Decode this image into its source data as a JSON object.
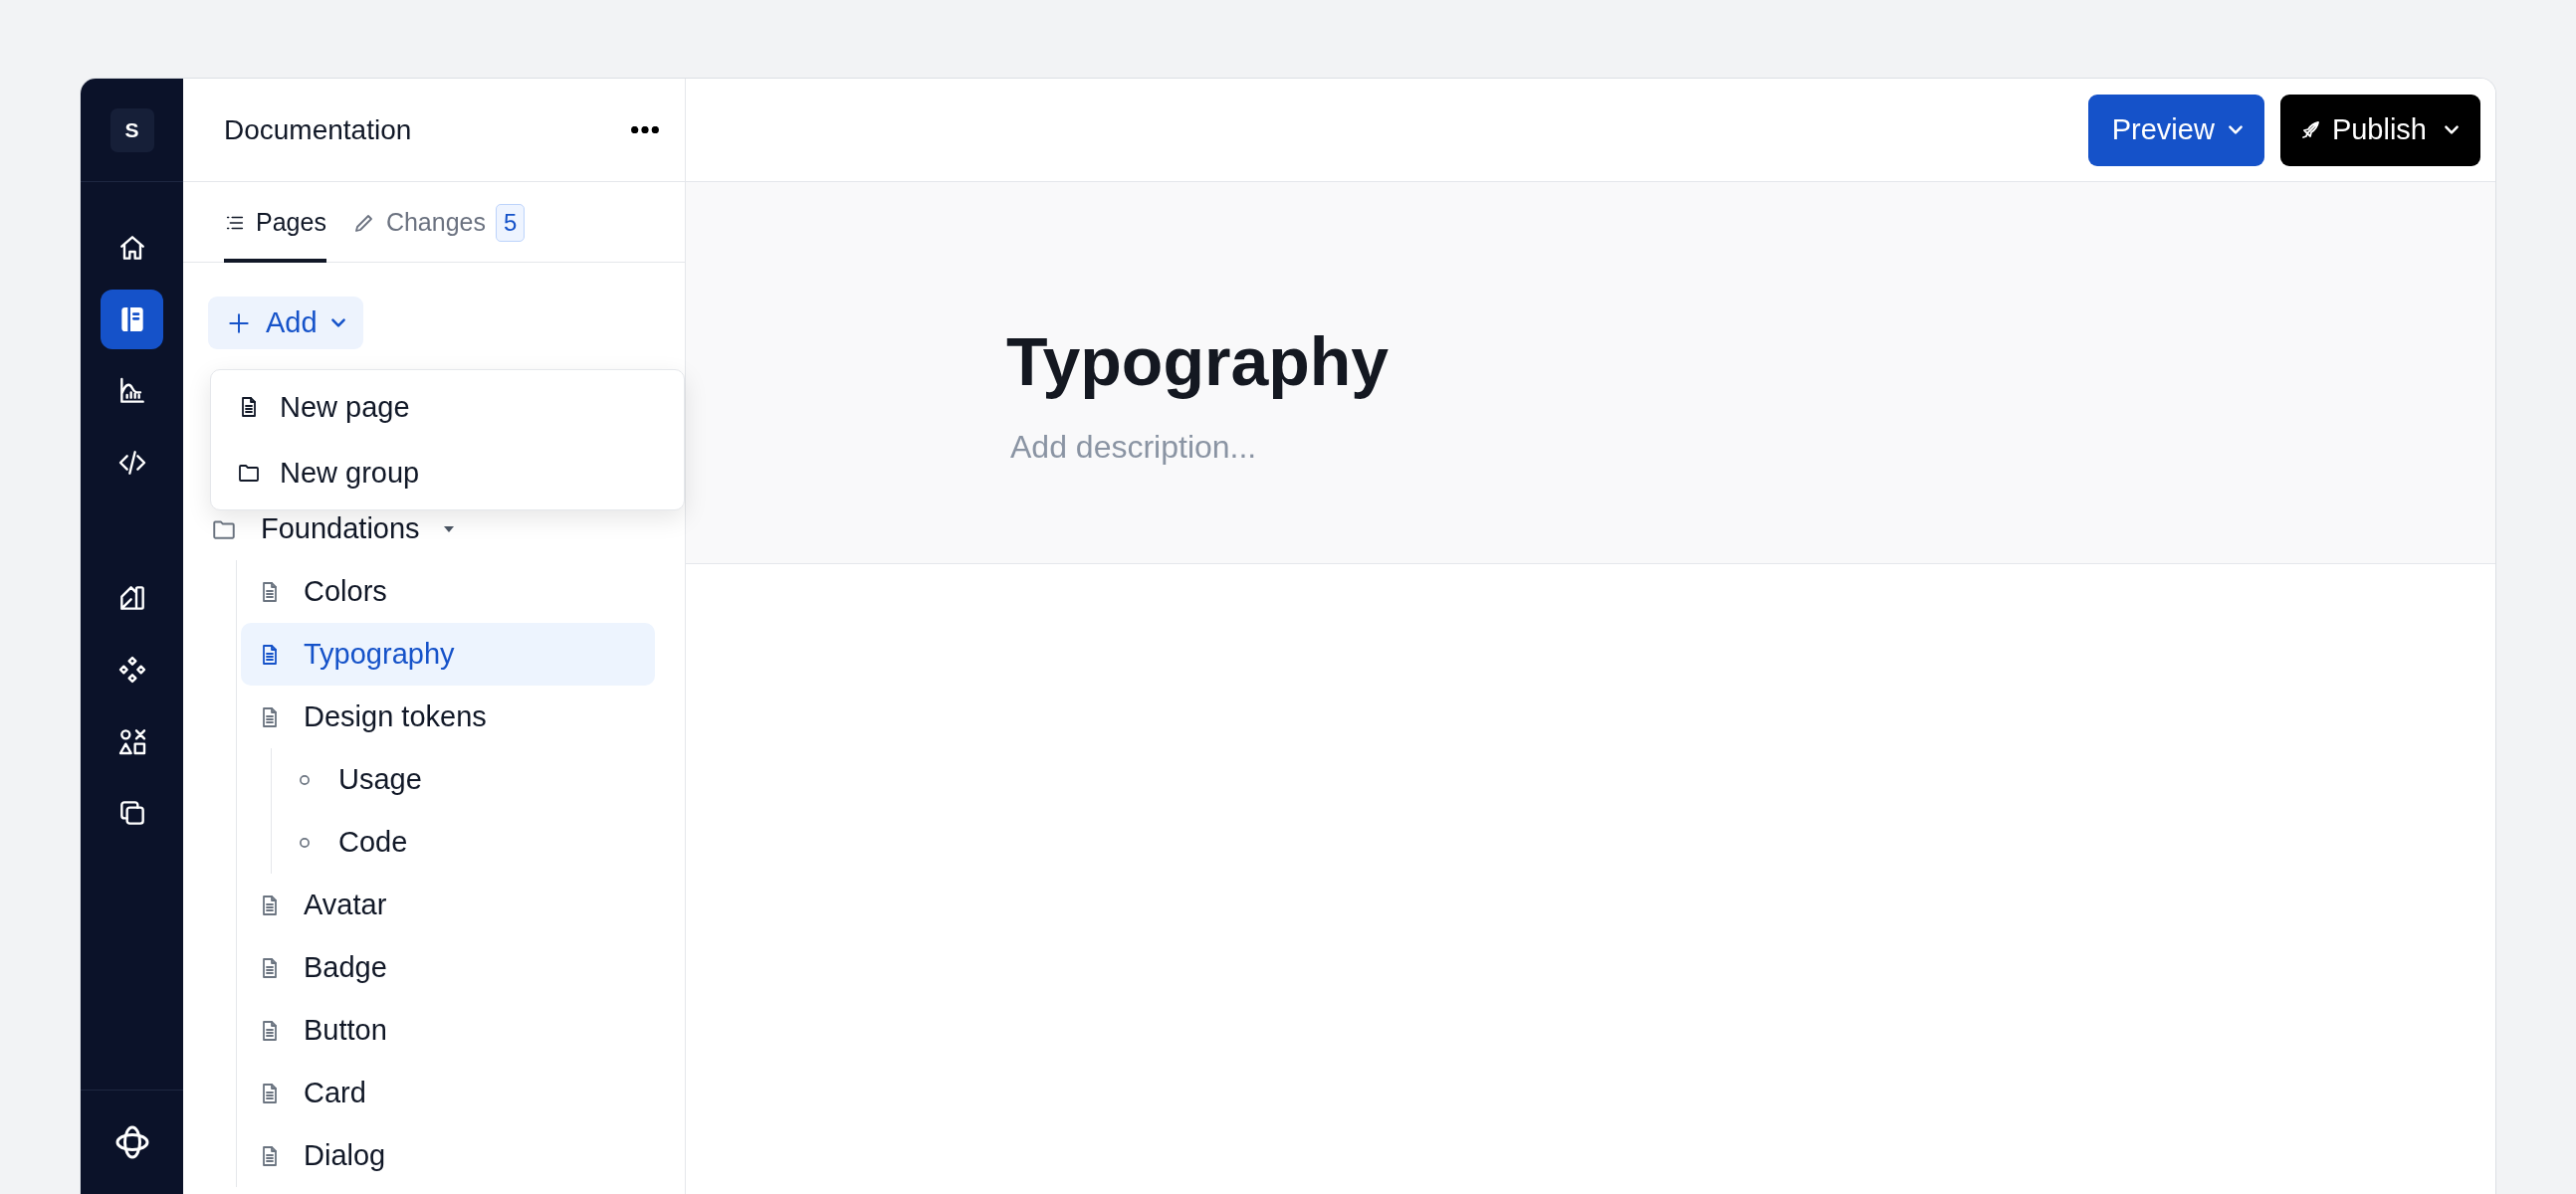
{
  "rail": {
    "logo": "S",
    "groups": [
      {
        "items": [
          {
            "selected": false
          },
          {
            "selected": true
          },
          {
            "selected": false
          },
          {
            "selected": false
          }
        ]
      },
      {
        "items": [
          {
            "selected": false
          },
          {
            "selected": false
          },
          {
            "selected": false
          },
          {
            "selected": false
          }
        ]
      }
    ]
  },
  "sidebar": {
    "title": "Documentation",
    "tabs": [
      {
        "label": "Pages",
        "selected": true
      },
      {
        "label": "Changes",
        "selected": false,
        "count": "5"
      }
    ],
    "add_button": "Add",
    "menu": [
      {
        "label": "New page",
        "kind": "page"
      },
      {
        "label": "New group",
        "kind": "folder"
      }
    ],
    "tree": [
      {
        "label": "Foundations",
        "kind": "folder",
        "expanded": true,
        "children": [
          {
            "label": "Colors",
            "kind": "page",
            "selected": false
          },
          {
            "label": "Typography",
            "kind": "page",
            "selected": true
          },
          {
            "label": "Design tokens",
            "kind": "page",
            "selected": false,
            "children": [
              {
                "label": "Usage",
                "kind": "section",
                "selected": false
              },
              {
                "label": "Code",
                "kind": "section",
                "selected": false
              }
            ]
          },
          {
            "label": "Avatar",
            "kind": "page",
            "selected": false
          },
          {
            "label": "Badge",
            "kind": "page",
            "selected": false
          },
          {
            "label": "Button",
            "kind": "page",
            "selected": false
          },
          {
            "label": "Card",
            "kind": "page",
            "selected": false
          },
          {
            "label": "Dialog",
            "kind": "page",
            "selected": false
          }
        ]
      }
    ]
  },
  "toolbar": {
    "buttons": [
      {
        "label": "Preview",
        "kind": "primary"
      },
      {
        "label": "Publish",
        "kind": "publish"
      }
    ]
  },
  "page": {
    "title": "Typography",
    "description": {
      "placeholder": "Add description..."
    }
  }
}
